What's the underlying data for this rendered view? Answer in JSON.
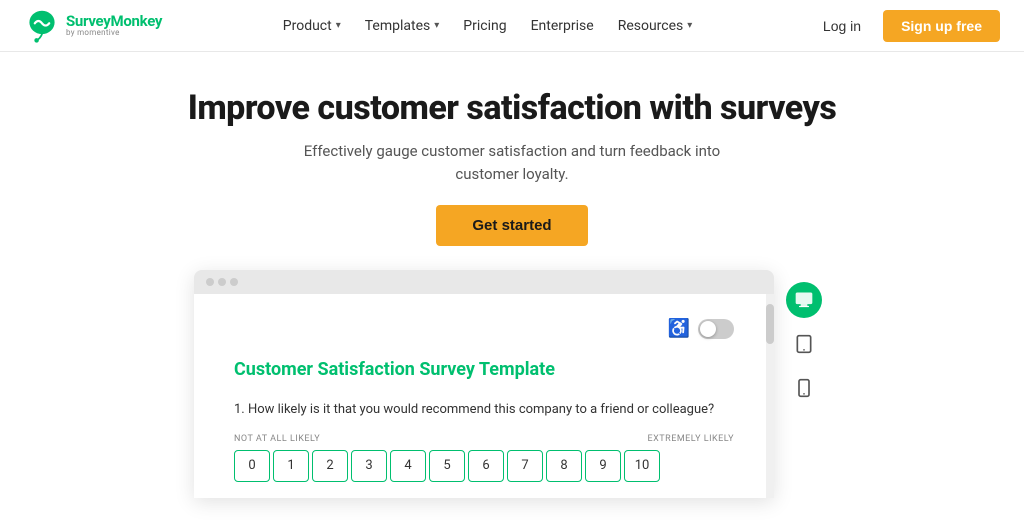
{
  "logo": {
    "main": "SurveyMonkey",
    "sub": "by momentive",
    "icon_color": "#00bf6f"
  },
  "nav": {
    "items": [
      {
        "label": "Product",
        "has_dropdown": true
      },
      {
        "label": "Templates",
        "has_dropdown": true
      },
      {
        "label": "Pricing",
        "has_dropdown": false
      },
      {
        "label": "Enterprise",
        "has_dropdown": false
      },
      {
        "label": "Resources",
        "has_dropdown": true
      }
    ],
    "login_label": "Log in",
    "signup_label": "Sign up free"
  },
  "hero": {
    "heading": "Improve customer satisfaction with surveys",
    "subheading": "Effectively gauge customer satisfaction and turn feedback into customer loyalty.",
    "cta_label": "Get started"
  },
  "survey_preview": {
    "title": "Customer Satisfaction Survey Template",
    "question": "1. How likely is it that you would recommend this company to a friend or colleague?",
    "scale_label_left": "NOT AT ALL LIKELY",
    "scale_label_right": "EXTREMELY LIKELY",
    "scale_numbers": [
      "0",
      "1",
      "2",
      "3",
      "4",
      "5",
      "6",
      "7",
      "8",
      "9",
      "10"
    ]
  },
  "devices": {
    "desktop_label": "Desktop view",
    "tablet_label": "Tablet view",
    "mobile_label": "Mobile view"
  }
}
